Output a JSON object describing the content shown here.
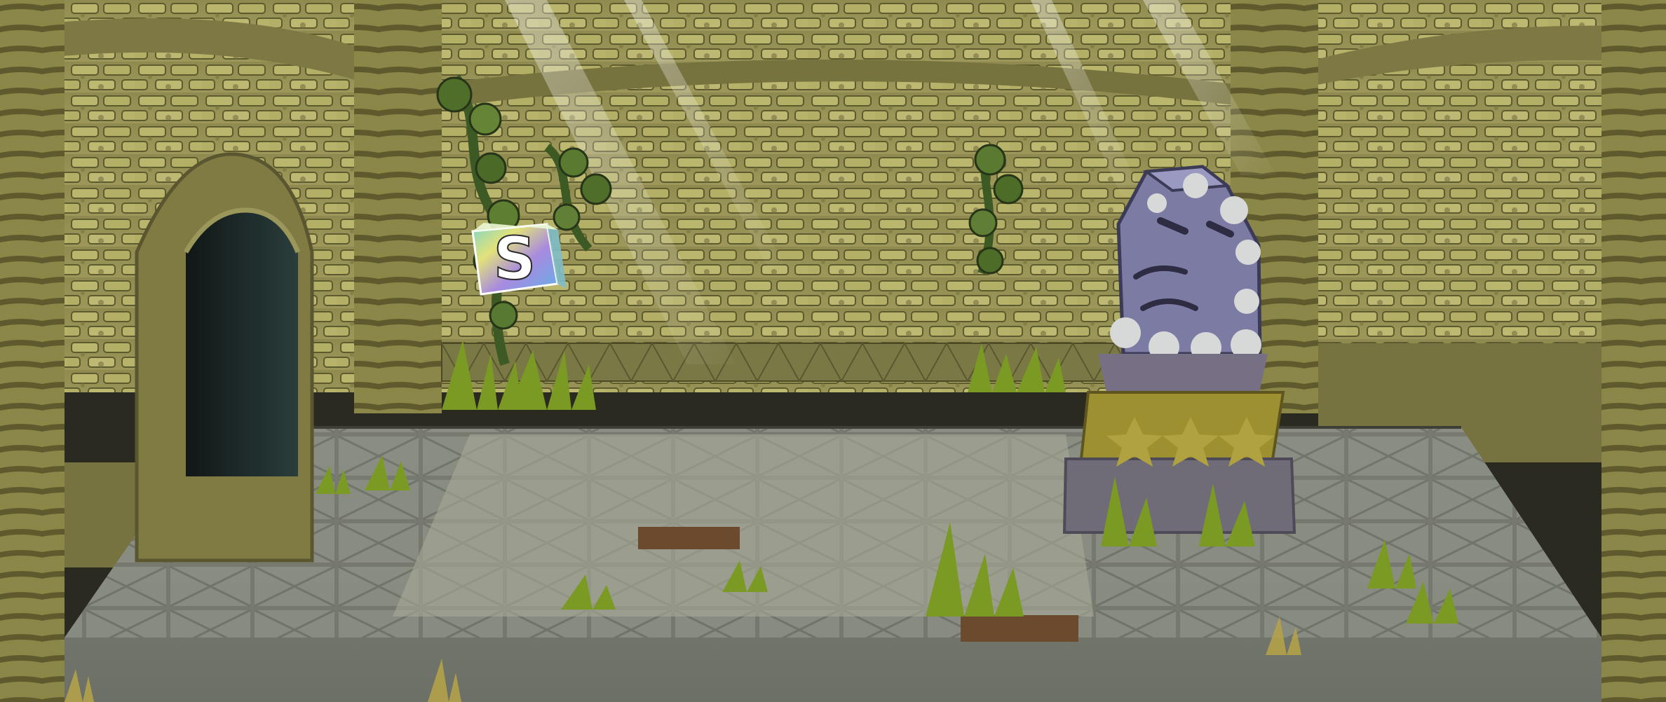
{
  "scene": {
    "save_block_symbol": "S",
    "icons": {
      "save_block": "save-block-icon",
      "statue": "stone-face-statue-icon",
      "doorway": "arched-doorway-icon",
      "vines": "hanging-vine-icon",
      "grass": "grass-tuft-icon"
    },
    "colors": {
      "wall": "#8f8a4f",
      "wall_shadow": "#5f5b2f",
      "brick": "#b8b46b",
      "floor_light": "#a8a893",
      "floor_dark": "#6f7368",
      "grout": "#4b4c43",
      "vine": "#4f6e2a",
      "grass": "#7a9a23",
      "statue": "#7c7ba4",
      "pedestal_gold": "#9c9030"
    }
  }
}
